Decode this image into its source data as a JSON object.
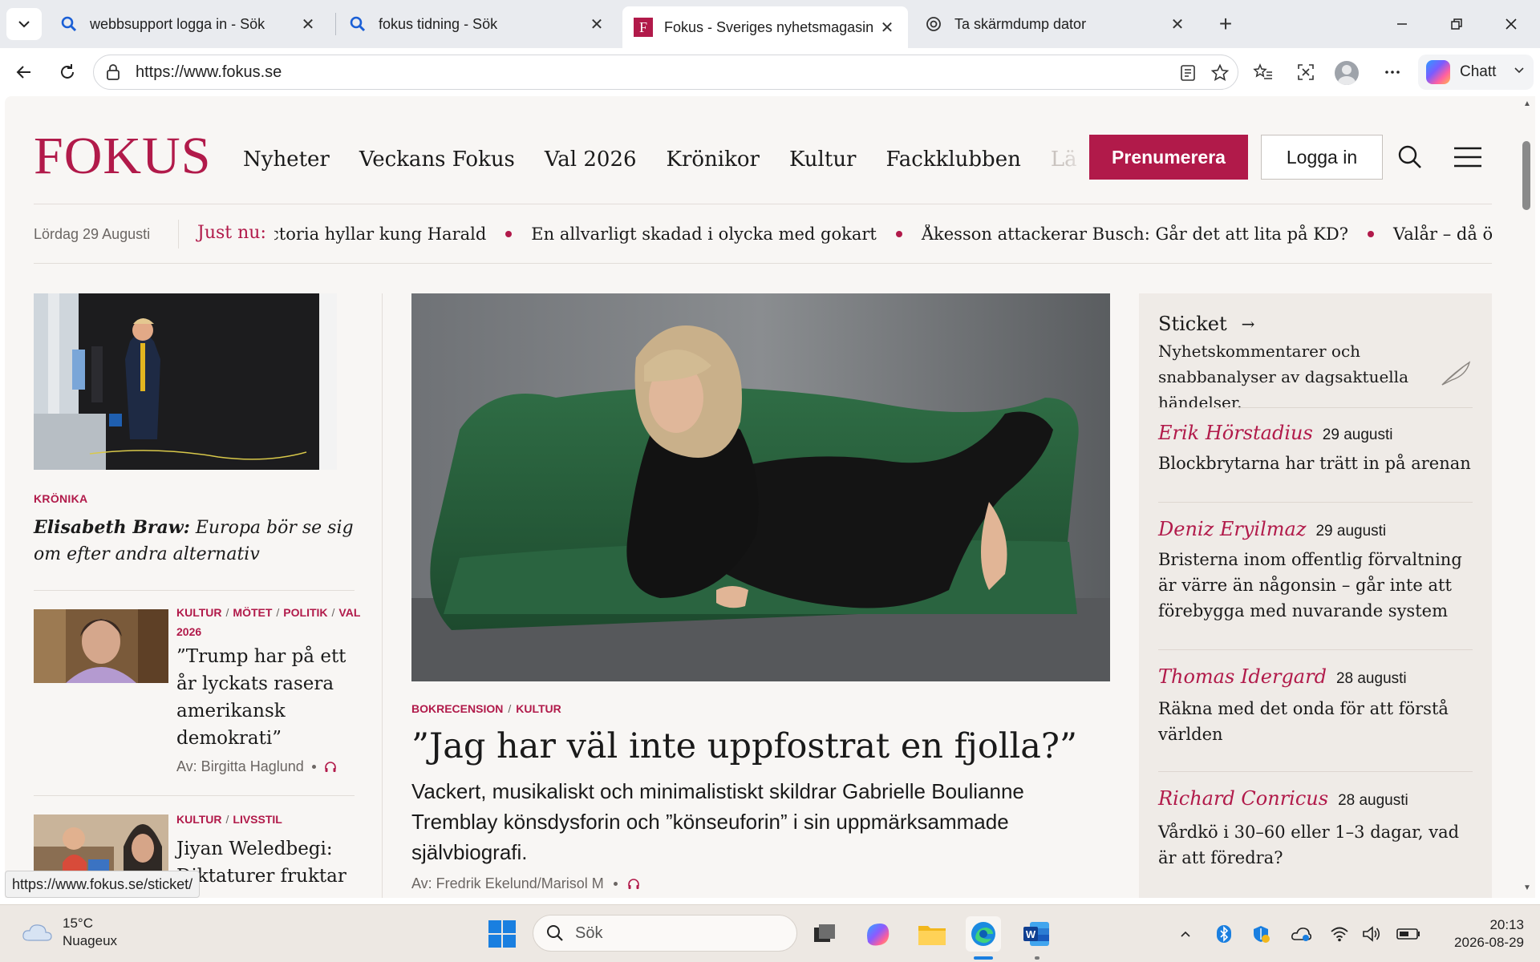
{
  "browser": {
    "tabs": [
      {
        "title": "webbsupport logga in - Sök",
        "icon": "search-icon",
        "active": false
      },
      {
        "title": "fokus tidning - Sök",
        "icon": "search-icon",
        "active": false
      },
      {
        "title": "Fokus - Sveriges nyhetsmagasin",
        "icon": "fokus-favicon",
        "active": true
      },
      {
        "title": "Ta skärmdump dator",
        "icon": "chatgpt-icon",
        "active": false
      }
    ],
    "url": "https://www.fokus.se",
    "chat_label": "Chatt"
  },
  "site": {
    "logo": "FOKUS",
    "nav": [
      "Nyheter",
      "Veckans Fokus",
      "Val 2026",
      "Krönikor",
      "Kultur",
      "Fackklubben",
      "Lä"
    ],
    "subscribe_label": "Prenumerera",
    "login_label": "Logga in",
    "accent": "#b11a4a"
  },
  "ticker": {
    "date": "Lördag 29 Augusti",
    "label": "Just nu:",
    "items": [
      "ctoria hyllar kung Harald",
      "En allvarligt skadad i olycka med gokart",
      "Åkesson attackerar Busch: Går det att lita på KD?",
      "Valår – då ökar klimat"
    ]
  },
  "left": {
    "lead": {
      "kicker": "KRÖNIKA",
      "author": "Elisabeth Braw:",
      "title": "Europa bör se sig om efter andra alternativ"
    },
    "items": [
      {
        "kickers": [
          "KULTUR",
          "MÖTET",
          "POLITIK",
          "VAL 2026"
        ],
        "title": "”Trump har på ett år lyckats rasera amerikansk demokrati”",
        "byline": "Av: Birgitta Haglund"
      },
      {
        "kickers": [
          "KULTUR",
          "LIVSSTIL"
        ],
        "title": "Jiyan Weledbegi: Diktaturer fruktar",
        "byline": ""
      }
    ]
  },
  "center": {
    "kickers": [
      "BOKRECENSION",
      "KULTUR"
    ],
    "title": "”Jag har väl inte uppfostrat en fjolla?”",
    "lede": "Vackert, musikaliskt och minimalistiskt skildrar Gabrielle Boulianne Tremblay könsdysforin och ”könseuforin” i sin uppmärksammade självbiografi.",
    "byline": "Av: Fredrik Ekelund/Marisol M"
  },
  "sticket": {
    "title": "Sticket",
    "description": "Nyhetskommentarer och snabbanalyser av dagsaktuella händelser.",
    "entries": [
      {
        "author": "Erik Hörstadius",
        "date": "29 augusti",
        "headline": "Blockbrytarna har trätt in på arenan"
      },
      {
        "author": "Deniz Eryilmaz",
        "date": "29 augusti",
        "headline": "Bristerna inom offentlig förvaltning är värre än någonsin – går inte att förebygga med nuvarande system"
      },
      {
        "author": "Thomas Idergard",
        "date": "28 augusti",
        "headline": "Räkna med det onda för att förstå världen"
      },
      {
        "author": "Richard Conricus",
        "date": "28 augusti",
        "headline": "Vårdkö i 30–60 eller 1–3 dagar, vad är att föredra?"
      }
    ]
  },
  "status_url": "https://www.fokus.se/sticket/",
  "taskbar": {
    "weather_temp": "15°C",
    "weather_desc": "Nuageux",
    "search_placeholder": "Sök",
    "time": "20:13",
    "date": "2026-08-29"
  }
}
